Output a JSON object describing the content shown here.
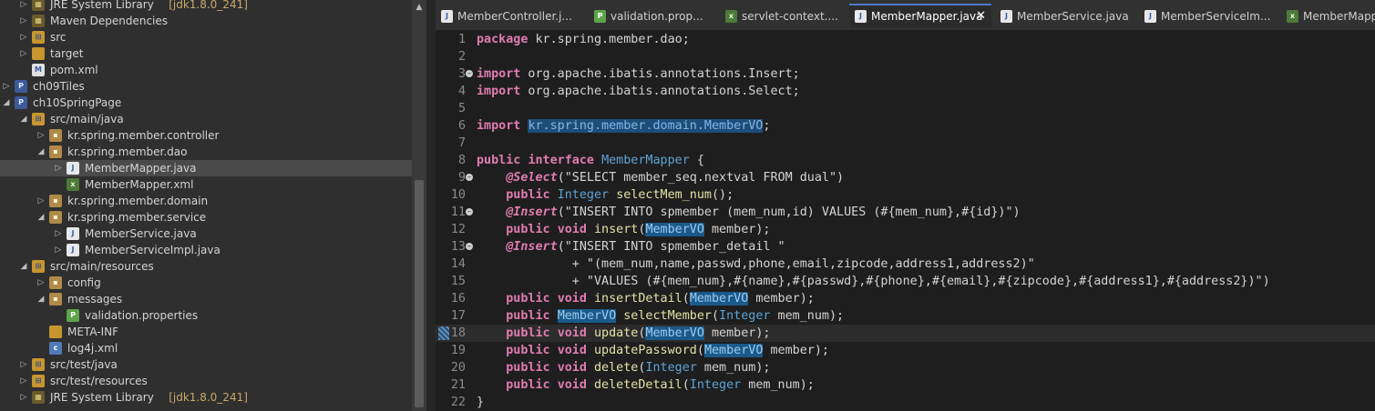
{
  "explorer": {
    "rows": [
      {
        "label": "JRE System Library",
        "decoration": "[jdk1.8.0_241]",
        "icon": "library-icon",
        "depth": 1,
        "expanded": false,
        "kind": "lib"
      },
      {
        "label": "Maven Dependencies",
        "decoration": "",
        "icon": "library-icon",
        "depth": 1,
        "expanded": false,
        "kind": "lib"
      },
      {
        "label": "src",
        "decoration": "",
        "icon": "source-folder-icon",
        "depth": 1,
        "expanded": false,
        "kind": "srcf"
      },
      {
        "label": "target",
        "decoration": "",
        "icon": "folder-icon",
        "depth": 1,
        "expanded": false,
        "kind": "folder"
      },
      {
        "label": "pom.xml",
        "decoration": "",
        "icon": "pom-file-icon",
        "depth": 1,
        "expanded": null,
        "kind": "pom"
      },
      {
        "label": "ch09Tiles",
        "decoration": "",
        "icon": "project-icon",
        "depth": 0,
        "expanded": false,
        "kind": "proj"
      },
      {
        "label": "ch10SpringPage",
        "decoration": "",
        "icon": "project-icon",
        "depth": 0,
        "expanded": true,
        "kind": "proj"
      },
      {
        "label": "src/main/java",
        "decoration": "",
        "icon": "source-folder-icon",
        "depth": 1,
        "expanded": true,
        "kind": "srcf"
      },
      {
        "label": "kr.spring.member.controller",
        "decoration": "",
        "icon": "package-icon",
        "depth": 2,
        "expanded": false,
        "kind": "pkg"
      },
      {
        "label": "kr.spring.member.dao",
        "decoration": "",
        "icon": "package-icon",
        "depth": 2,
        "expanded": true,
        "kind": "pkg"
      },
      {
        "label": "MemberMapper.java",
        "decoration": "",
        "icon": "java-file-icon",
        "depth": 3,
        "expanded": false,
        "kind": "java",
        "selected": true
      },
      {
        "label": "MemberMapper.xml",
        "decoration": "",
        "icon": "xml-file-icon",
        "depth": 3,
        "expanded": null,
        "kind": "xml"
      },
      {
        "label": "kr.spring.member.domain",
        "decoration": "",
        "icon": "package-icon",
        "depth": 2,
        "expanded": false,
        "kind": "pkg"
      },
      {
        "label": "kr.spring.member.service",
        "decoration": "",
        "icon": "package-icon",
        "depth": 2,
        "expanded": true,
        "kind": "pkg"
      },
      {
        "label": "MemberService.java",
        "decoration": "",
        "icon": "java-file-icon",
        "depth": 3,
        "expanded": false,
        "kind": "java"
      },
      {
        "label": "MemberServiceImpl.java",
        "decoration": "",
        "icon": "java-file-icon",
        "depth": 3,
        "expanded": false,
        "kind": "java"
      },
      {
        "label": "src/main/resources",
        "decoration": "",
        "icon": "source-folder-icon",
        "depth": 1,
        "expanded": true,
        "kind": "srcf"
      },
      {
        "label": "config",
        "decoration": "",
        "icon": "package-icon",
        "depth": 2,
        "expanded": false,
        "kind": "pkg"
      },
      {
        "label": "messages",
        "decoration": "",
        "icon": "package-icon",
        "depth": 2,
        "expanded": true,
        "kind": "pkg"
      },
      {
        "label": "validation.properties",
        "decoration": "",
        "icon": "properties-file-icon",
        "depth": 3,
        "expanded": null,
        "kind": "props"
      },
      {
        "label": "META-INF",
        "decoration": "",
        "icon": "folder-icon",
        "depth": 2,
        "expanded": null,
        "kind": "folder"
      },
      {
        "label": "log4j.xml",
        "decoration": "",
        "icon": "config-file-icon",
        "depth": 2,
        "expanded": null,
        "kind": "cfg"
      },
      {
        "label": "src/test/java",
        "decoration": "",
        "icon": "source-folder-icon",
        "depth": 1,
        "expanded": false,
        "kind": "srcf"
      },
      {
        "label": "src/test/resources",
        "decoration": "",
        "icon": "source-folder-icon",
        "depth": 1,
        "expanded": false,
        "kind": "srcf"
      },
      {
        "label": "JRE System Library",
        "decoration": "[jdk1.8.0_241]",
        "icon": "library-icon",
        "depth": 1,
        "expanded": false,
        "kind": "lib"
      }
    ]
  },
  "tabs": [
    {
      "label": "MemberController.j...",
      "icon": "java-file-icon",
      "kind": "java",
      "active": false
    },
    {
      "label": "validation.prop...",
      "icon": "properties-file-icon",
      "kind": "props",
      "active": false
    },
    {
      "label": "servlet-context....",
      "icon": "xml-file-icon",
      "kind": "xml",
      "active": false
    },
    {
      "label": "MemberMapper.java",
      "icon": "java-file-icon",
      "kind": "java",
      "active": true,
      "close": "✕"
    },
    {
      "label": "MemberService.java",
      "icon": "java-file-icon",
      "kind": "java",
      "active": false
    },
    {
      "label": "MemberServiceIm...",
      "icon": "java-file-icon",
      "kind": "java",
      "active": false
    },
    {
      "label": "MemberMapper...",
      "icon": "xml-file-icon",
      "kind": "xml",
      "active": false
    }
  ],
  "editor": {
    "current_line": 18,
    "lines": [
      {
        "n": "1",
        "fold": false,
        "segs": [
          [
            "kw2",
            "package"
          ],
          [
            "pl",
            " kr.spring.member.dao;"
          ]
        ]
      },
      {
        "n": "2",
        "fold": false,
        "segs": []
      },
      {
        "n": "3",
        "fold": true,
        "segs": [
          [
            "kw2",
            "import"
          ],
          [
            "pl",
            " org.apache.ibatis.annotations.Insert;"
          ]
        ]
      },
      {
        "n": "4",
        "fold": false,
        "segs": [
          [
            "kw2",
            "import"
          ],
          [
            "pl",
            " org.apache.ibatis.annotations.Select;"
          ]
        ]
      },
      {
        "n": "5",
        "fold": false,
        "segs": []
      },
      {
        "n": "6",
        "fold": false,
        "segs": [
          [
            "kw2",
            "import"
          ],
          [
            "pl",
            " "
          ],
          [
            "hl",
            "kr.spring.member.domain.MemberVO"
          ],
          [
            "pl",
            ";"
          ]
        ]
      },
      {
        "n": "7",
        "fold": false,
        "segs": []
      },
      {
        "n": "8",
        "fold": false,
        "segs": [
          [
            "kw2",
            "public"
          ],
          [
            "pl",
            " "
          ],
          [
            "kw2",
            "interface"
          ],
          [
            "pl",
            " "
          ],
          [
            "ty",
            "MemberMapper"
          ],
          [
            "pl",
            " {"
          ]
        ]
      },
      {
        "n": "9",
        "fold": true,
        "segs": [
          [
            "pl",
            "    "
          ],
          [
            "ann",
            "@Select"
          ],
          [
            "pl",
            "(\"SELECT member_seq.nextval FROM dual\")"
          ]
        ]
      },
      {
        "n": "10",
        "fold": false,
        "segs": [
          [
            "pl",
            "    "
          ],
          [
            "kw2",
            "public"
          ],
          [
            "pl",
            " "
          ],
          [
            "ty",
            "Integer"
          ],
          [
            "pl",
            " "
          ],
          [
            "meth",
            "selectMem_num"
          ],
          [
            "pl",
            "();"
          ]
        ]
      },
      {
        "n": "11",
        "fold": true,
        "segs": [
          [
            "pl",
            "    "
          ],
          [
            "ann",
            "@Insert"
          ],
          [
            "pl",
            "(\"INSERT INTO spmember (mem_num,id) VALUES (#{mem_num},#{id})\")"
          ]
        ]
      },
      {
        "n": "12",
        "fold": false,
        "segs": [
          [
            "pl",
            "    "
          ],
          [
            "kw2",
            "public"
          ],
          [
            "pl",
            " "
          ],
          [
            "kw2",
            "void"
          ],
          [
            "pl",
            " "
          ],
          [
            "meth",
            "insert"
          ],
          [
            "pl",
            "("
          ],
          [
            "hl2",
            "MemberVO"
          ],
          [
            "pl",
            " member);"
          ]
        ]
      },
      {
        "n": "13",
        "fold": true,
        "segs": [
          [
            "pl",
            "    "
          ],
          [
            "ann",
            "@Insert"
          ],
          [
            "pl",
            "(\"INSERT INTO spmember_detail \""
          ]
        ]
      },
      {
        "n": "14",
        "fold": false,
        "segs": [
          [
            "pl",
            "             + \"(mem_num,name,passwd,phone,email,zipcode,address1,address2)\""
          ]
        ]
      },
      {
        "n": "15",
        "fold": false,
        "segs": [
          [
            "pl",
            "             + \"VALUES (#{mem_num},#{name},#{passwd},#{phone},#{email},#{zipcode},#{address1},#{address2})\")"
          ]
        ]
      },
      {
        "n": "16",
        "fold": false,
        "segs": [
          [
            "pl",
            "    "
          ],
          [
            "kw2",
            "public"
          ],
          [
            "pl",
            " "
          ],
          [
            "kw2",
            "void"
          ],
          [
            "pl",
            " "
          ],
          [
            "meth",
            "insertDetail"
          ],
          [
            "pl",
            "("
          ],
          [
            "hl2",
            "MemberVO"
          ],
          [
            "pl",
            " member);"
          ]
        ]
      },
      {
        "n": "17",
        "fold": false,
        "segs": [
          [
            "pl",
            "    "
          ],
          [
            "kw2",
            "public"
          ],
          [
            "pl",
            " "
          ],
          [
            "hl2",
            "MemberVO"
          ],
          [
            "pl",
            " "
          ],
          [
            "meth",
            "selectMember"
          ],
          [
            "pl",
            "("
          ],
          [
            "ty",
            "Integer"
          ],
          [
            "pl",
            " mem_num);"
          ]
        ]
      },
      {
        "n": "18",
        "fold": false,
        "segs": [
          [
            "pl",
            "    "
          ],
          [
            "kw2",
            "public"
          ],
          [
            "pl",
            " "
          ],
          [
            "kw2",
            "void"
          ],
          [
            "pl",
            " "
          ],
          [
            "meth",
            "update"
          ],
          [
            "pl",
            "("
          ],
          [
            "hl2",
            "MemberVO"
          ],
          [
            "pl",
            " member);"
          ]
        ]
      },
      {
        "n": "19",
        "fold": false,
        "segs": [
          [
            "pl",
            "    "
          ],
          [
            "kw2",
            "public"
          ],
          [
            "pl",
            " "
          ],
          [
            "kw2",
            "void"
          ],
          [
            "pl",
            " "
          ],
          [
            "meth",
            "updatePassword"
          ],
          [
            "pl",
            "("
          ],
          [
            "hl2",
            "MemberVO"
          ],
          [
            "pl",
            " member);"
          ]
        ]
      },
      {
        "n": "20",
        "fold": false,
        "segs": [
          [
            "pl",
            "    "
          ],
          [
            "kw2",
            "public"
          ],
          [
            "pl",
            " "
          ],
          [
            "kw2",
            "void"
          ],
          [
            "pl",
            " "
          ],
          [
            "meth",
            "delete"
          ],
          [
            "pl",
            "("
          ],
          [
            "ty",
            "Integer"
          ],
          [
            "pl",
            " mem_num);"
          ]
        ]
      },
      {
        "n": "21",
        "fold": false,
        "segs": [
          [
            "pl",
            "    "
          ],
          [
            "kw2",
            "public"
          ],
          [
            "pl",
            " "
          ],
          [
            "kw2",
            "void"
          ],
          [
            "pl",
            " "
          ],
          [
            "meth",
            "deleteDetail"
          ],
          [
            "pl",
            "("
          ],
          [
            "ty",
            "Integer"
          ],
          [
            "pl",
            " mem_num);"
          ]
        ]
      },
      {
        "n": "22",
        "fold": false,
        "segs": [
          [
            "pl",
            "}"
          ]
        ]
      }
    ]
  },
  "colors": {
    "keyword": "#e07cb0",
    "type": "#5ea4d6",
    "plain": "#d4d4d4",
    "highlight": "#1f4d7a",
    "decoration": "#c9a86a"
  }
}
